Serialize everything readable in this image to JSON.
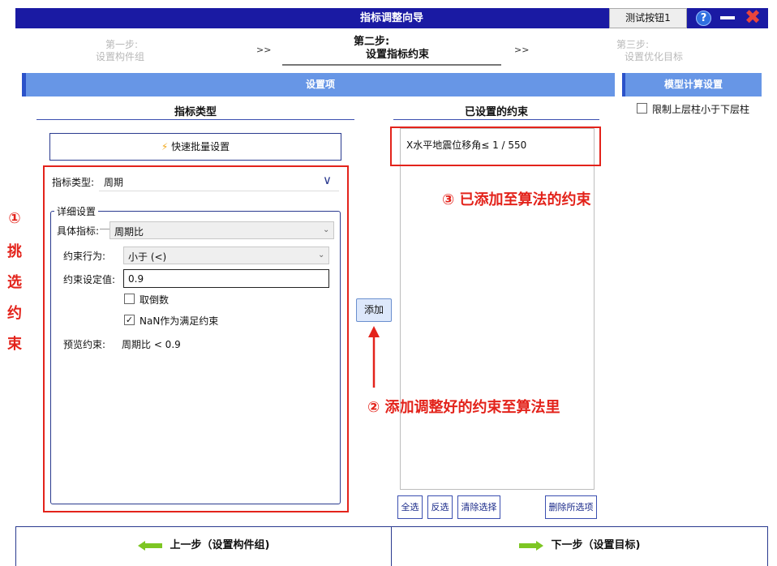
{
  "window": {
    "title": "指标调整向导",
    "test_button": "测试按钮1",
    "help_icon": "?",
    "minimize_icon": "minimize-icon",
    "close_icon": "✖"
  },
  "steps": {
    "step1": {
      "line1": "第一步:",
      "line2": "设置构件组"
    },
    "sep1": ">>",
    "step2": {
      "line1": "第二步:",
      "line2": "设置指标约束"
    },
    "sep2": ">>",
    "step3": {
      "line1": "第三步:",
      "line2": "设置优化目标"
    }
  },
  "sections": {
    "settings": "设置项",
    "model_calc": "模型计算设置",
    "limit_checkbox": "限制上层柱小于下层柱"
  },
  "left": {
    "title": "指标类型",
    "quick_batch": "快速批量设置",
    "indicator_type_label": "指标类型:",
    "indicator_type_value": "周期",
    "detail_group": "详细设置",
    "specific_label": "具体指标:",
    "specific_value": "周期比",
    "behavior_label": "约束行为:",
    "behavior_value": "小于 (<)",
    "setvalue_label": "约束设定值:",
    "setvalue_value": "0.9",
    "reciprocal_label": "取倒数",
    "reciprocal_checked": false,
    "nan_label": "NaN作为满足约束",
    "nan_checked": true,
    "preview_label": "预览约束:",
    "preview_value": "周期比 < 0.9"
  },
  "add_button": "添加",
  "right": {
    "title": "已设置的约束",
    "constraints": [
      "X水平地震位移角≤ 1 / 550"
    ],
    "buttons": {
      "select_all": "全选",
      "invert": "反选",
      "clear": "清除选择",
      "delete": "删除所选项"
    }
  },
  "annotations": {
    "side_number": "①",
    "side_chars": [
      "挑",
      "选",
      "约",
      "束"
    ],
    "note2": "② 添加调整好的约束至算法里",
    "note3": "③ 已添加至算法的约束"
  },
  "footer": {
    "prev": "上一步（设置构件组)",
    "next": "下一步（设置目标)"
  },
  "colors": {
    "titlebar": "#1a1aa3",
    "section_bar": "#6796e6",
    "annotation_red": "#e3231b",
    "arrow_green": "#7dc623"
  }
}
